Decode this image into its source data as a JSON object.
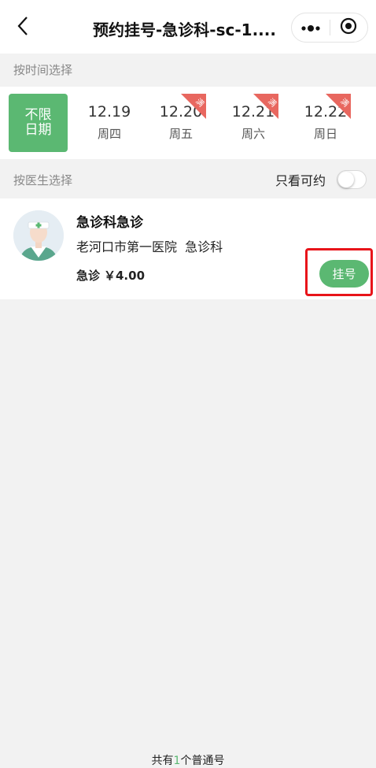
{
  "navbar": {
    "title": "预约挂号-急诊科-sc-1....",
    "back_icon": "chevron-left-icon",
    "more_icon": "more-dots-icon",
    "target_icon": "target-circle-icon"
  },
  "time_section": {
    "label": "按时间选择",
    "unlimited_line1": "不限",
    "unlimited_line2": "日期",
    "dates": [
      {
        "date": "12.19",
        "weekday": "周四",
        "full": false
      },
      {
        "date": "12.20",
        "weekday": "周五",
        "full": true,
        "badge": "满"
      },
      {
        "date": "12.21",
        "weekday": "周六",
        "full": true,
        "badge": "满"
      },
      {
        "date": "12.22",
        "weekday": "周日",
        "full": true,
        "badge": "满"
      }
    ]
  },
  "doctor_section": {
    "label": "按医生选择",
    "filter_label": "只看可约",
    "filter_on": false
  },
  "doctor": {
    "name": "急诊科急诊",
    "dept": "老河口市第一医院  急诊科",
    "fee_label": "急诊",
    "fee_value": "￥4.00",
    "book_button": "挂号"
  },
  "footer": {
    "prefix": "共有",
    "count": "1",
    "suffix": "个普通号"
  },
  "colors": {
    "accent": "#5bb872",
    "badge": "#e8675f",
    "highlight": "#e8141a"
  }
}
